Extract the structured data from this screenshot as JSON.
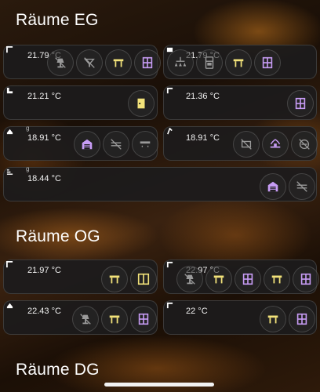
{
  "sections": {
    "eg": "Räume EG",
    "og": "Räume OG",
    "dg": "Räume DG"
  },
  "colors": {
    "yellow": "#f2e27a",
    "purple": "#c79cf5",
    "grey": "#9a9a9a"
  },
  "rooms": {
    "eg1": {
      "temp": "21.79 °C",
      "icons": [
        "lamp-off-icon",
        "light-off-icon",
        "table-icon",
        "window-icon"
      ]
    },
    "eg2": {
      "temp": "21.79 °C",
      "icons": [
        "chandelier-icon",
        "fridge-icon",
        "table-icon",
        "window-icon"
      ]
    },
    "eg3": {
      "temp": "21.21 °C",
      "icons": [
        "door-icon"
      ]
    },
    "eg4": {
      "temp": "21.36 °C",
      "icons": [
        "window-icon"
      ]
    },
    "eg5": {
      "temp": "18.91 °C",
      "icons": [
        "garage-icon",
        "light-strip-off-icon",
        "ceiling-light-icon"
      ]
    },
    "eg6": {
      "temp": "18.91 °C",
      "icons": [
        "outdoor-light-off-icon",
        "fountain-icon",
        "no-sprinkler-icon"
      ]
    },
    "eg7": {
      "temp": "18.44 °C",
      "icons": [
        "garage-icon",
        "light-strip-off-icon"
      ]
    },
    "og1": {
      "temp": "21.97 °C",
      "icons": [
        "table-icon",
        "door-wide-icon"
      ]
    },
    "og2": {
      "temp": "22.97 °C",
      "icons": [
        "lamp-off-icon",
        "table-icon",
        "window-icon",
        "table-icon",
        "window-icon"
      ]
    },
    "og3": {
      "temp": "22.43 °C",
      "icons": [
        "lamp-off-icon",
        "table-icon",
        "window-icon"
      ]
    },
    "og4": {
      "temp": "22 °C",
      "icons": [
        "table-icon",
        "window-icon"
      ]
    }
  }
}
